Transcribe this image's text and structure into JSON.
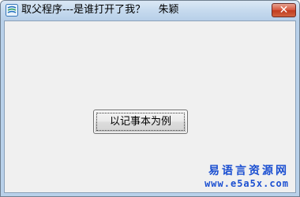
{
  "window": {
    "title": "取父程序---是谁打开了我？    朱颖",
    "close_label": "✕",
    "icon": "app-logo-icon",
    "colors": {
      "titlebar": "#c6daee",
      "close": "#c9432a",
      "client": "#f0f0f0",
      "watermark": "#1b4fd1"
    }
  },
  "main": {
    "button_label": "以记事本为例"
  },
  "watermark": {
    "site_name": "易语言资源网",
    "url": "www.e5a5x.com"
  }
}
